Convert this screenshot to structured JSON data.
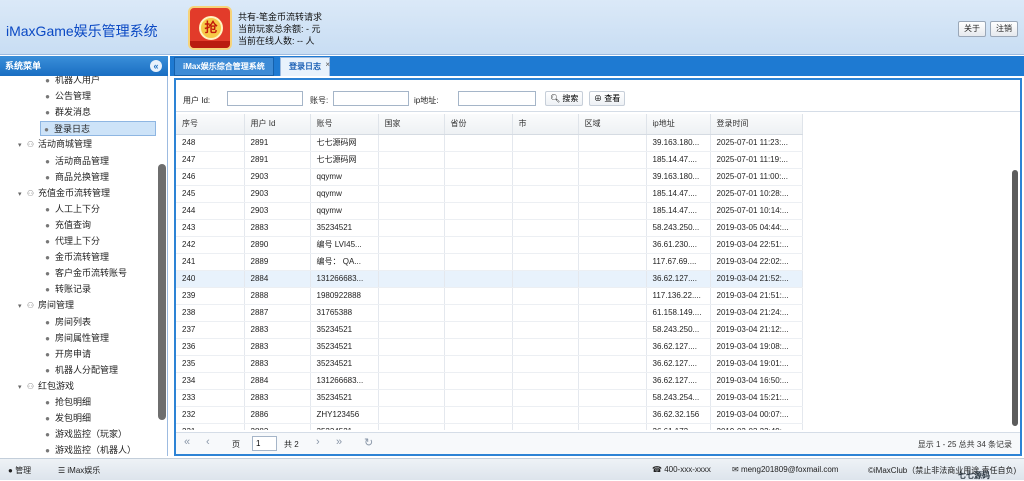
{
  "header": {
    "app_title": "iMaxGame娱乐管理系统",
    "logo_char": "抢",
    "info_line1": "共有-笔金币流转请求",
    "info_line2": "当前玩家总余额: - 元",
    "info_line3": "当前在线人数: -- 人",
    "about_label": "关于",
    "logout_label": "注销"
  },
  "sidebar": {
    "title": "系统菜单",
    "items": [
      {
        "label": "机器人用户",
        "level": 2
      },
      {
        "label": "公告管理",
        "level": 2
      },
      {
        "label": "群发消息",
        "level": 2
      },
      {
        "label": "登录日志",
        "level": 2,
        "selected": true
      },
      {
        "label": "活动商城管理",
        "level": 1
      },
      {
        "label": "活动商品管理",
        "level": 2
      },
      {
        "label": "商品兑换管理",
        "level": 2
      },
      {
        "label": "充值金币流转管理",
        "level": 1
      },
      {
        "label": "人工上下分",
        "level": 2
      },
      {
        "label": "充值查询",
        "level": 2
      },
      {
        "label": "代理上下分",
        "level": 2
      },
      {
        "label": "金币流转管理",
        "level": 2
      },
      {
        "label": "客户金币流转账号",
        "level": 2
      },
      {
        "label": "转账记录",
        "level": 2
      },
      {
        "label": "房间管理",
        "level": 1
      },
      {
        "label": "房间列表",
        "level": 2
      },
      {
        "label": "房间属性管理",
        "level": 2
      },
      {
        "label": "开房申请",
        "level": 2
      },
      {
        "label": "机器人分配管理",
        "level": 2
      },
      {
        "label": "红包游戏",
        "level": 1
      },
      {
        "label": "抢包明细",
        "level": 2
      },
      {
        "label": "发包明细",
        "level": 2
      },
      {
        "label": "游戏监控（玩家）",
        "level": 2
      },
      {
        "label": "游戏监控（机器人）",
        "level": 2
      }
    ]
  },
  "tabs": [
    {
      "label": "iMax娱乐综合管理系统"
    },
    {
      "label": "登录日志",
      "closable": true
    }
  ],
  "search": {
    "user_id_label": "用户 Id:",
    "account_label": "账号:",
    "ip_label": "ip地址:",
    "search_button": "搜索",
    "view_button": "查看"
  },
  "table": {
    "columns": [
      "序号",
      "用户 Id",
      "账号",
      "国家",
      "省份",
      "市",
      "区域",
      "ip地址",
      "登录时间"
    ],
    "rows": [
      [
        "248",
        "2891",
        "七七源码网",
        "",
        "",
        "",
        "",
        "39.163.180...",
        "2025-07-01 11:23:..."
      ],
      [
        "247",
        "2891",
        "七七源码网",
        "",
        "",
        "",
        "",
        "185.14.47....",
        "2025-07-01 11:19:..."
      ],
      [
        "246",
        "2903",
        "qqymw",
        "",
        "",
        "",
        "",
        "39.163.180...",
        "2025-07-01 11:00:..."
      ],
      [
        "245",
        "2903",
        "qqymw",
        "",
        "",
        "",
        "",
        "185.14.47....",
        "2025-07-01 10:28:..."
      ],
      [
        "244",
        "2903",
        "qqymw",
        "",
        "",
        "",
        "",
        "185.14.47....",
        "2025-07-01 10:14:..."
      ],
      [
        "243",
        "2883",
        "35234521",
        "",
        "",
        "",
        "",
        "58.243.250...",
        "2019-03-05 04:44:..."
      ],
      [
        "242",
        "2890",
        "编号 LVI45...",
        "",
        "",
        "",
        "",
        "36.61.230....",
        "2019-03-04 22:51:..."
      ],
      [
        "241",
        "2889",
        "编号： QA...",
        "",
        "",
        "",
        "",
        "117.67.69....",
        "2019-03-04 22:02:..."
      ],
      [
        "240",
        "2884",
        "131266683...",
        "",
        "",
        "",
        "",
        "36.62.127....",
        "2019-03-04 21:52:..."
      ],
      [
        "239",
        "2888",
        "1980922888",
        "",
        "",
        "",
        "",
        "117.136.22....",
        "2019-03-04 21:51:..."
      ],
      [
        "238",
        "2887",
        "31765388",
        "",
        "",
        "",
        "",
        "61.158.149....",
        "2019-03-04 21:24:..."
      ],
      [
        "237",
        "2883",
        "35234521",
        "",
        "",
        "",
        "",
        "58.243.250...",
        "2019-03-04 21:12:..."
      ],
      [
        "236",
        "2883",
        "35234521",
        "",
        "",
        "",
        "",
        "36.62.127....",
        "2019-03-04 19:08:..."
      ],
      [
        "235",
        "2883",
        "35234521",
        "",
        "",
        "",
        "",
        "36.62.127....",
        "2019-03-04 19:01:..."
      ],
      [
        "234",
        "2884",
        "131266683...",
        "",
        "",
        "",
        "",
        "36.62.127....",
        "2019-03-04 16:50:..."
      ],
      [
        "233",
        "2883",
        "35234521",
        "",
        "",
        "",
        "",
        "58.243.254...",
        "2019-03-04 15:21:..."
      ],
      [
        "232",
        "2886",
        "ZHY123456",
        "",
        "",
        "",
        "",
        "36.62.32.156",
        "2019-03-04 00:07:..."
      ],
      [
        "231",
        "2883",
        "35234521",
        "",
        "",
        "",
        "",
        "36.61.172....",
        "2019-03-03 23:49:..."
      ]
    ],
    "highlighted_row": 8
  },
  "pager": {
    "page_label": "页",
    "page_value": "1",
    "total_pages": "共 2",
    "info": "显示 1 - 25 总共 34 条记录"
  },
  "footer": {
    "user_label": "管理",
    "org_label": "iMax娱乐",
    "phone": "400-xxx-xxxx",
    "email": "meng201809@foxmail.com",
    "copyright": "©iMaxClub（禁止非法商业用途 责任自负)"
  },
  "watermark": "七七源码"
}
